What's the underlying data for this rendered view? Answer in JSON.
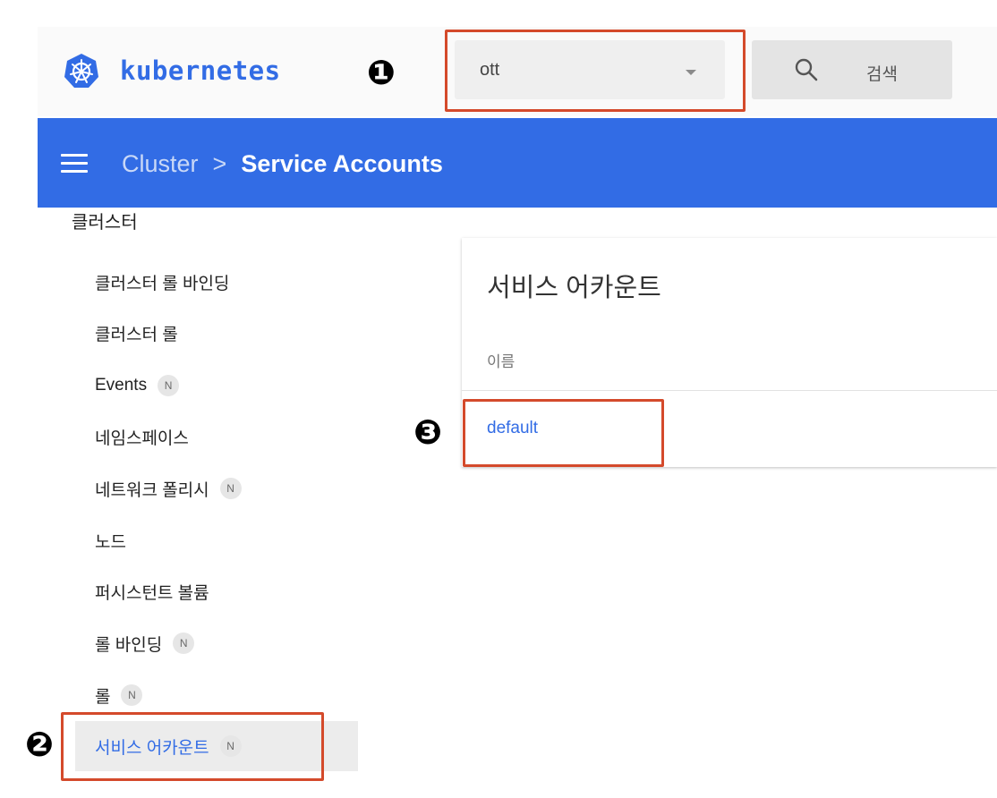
{
  "brand": {
    "name": "kubernetes",
    "color": "#326ce5"
  },
  "namespace_select": {
    "value": "ott"
  },
  "search": {
    "label": "검색"
  },
  "breadcrumb": {
    "parent": "Cluster",
    "separator": ">",
    "current": "Service Accounts"
  },
  "sidebar": {
    "section_title": "클러스터",
    "items": [
      {
        "label": "클러스터 롤 바인딩",
        "badge": ""
      },
      {
        "label": "클러스터 롤",
        "badge": ""
      },
      {
        "label": "Events",
        "badge": "N"
      },
      {
        "label": "네임스페이스",
        "badge": ""
      },
      {
        "label": "네트워크 폴리시",
        "badge": "N"
      },
      {
        "label": "노드",
        "badge": ""
      },
      {
        "label": "퍼시스턴트 볼륨",
        "badge": ""
      },
      {
        "label": "롤 바인딩",
        "badge": "N"
      },
      {
        "label": "롤",
        "badge": "N"
      },
      {
        "label": "서비스 어카운트",
        "badge": "N",
        "active": true
      }
    ]
  },
  "main": {
    "card_title": "서비스 어카운트",
    "column_header": "이름",
    "rows": [
      "default"
    ]
  },
  "annotations": {
    "marker_1": "❶",
    "marker_2": "❷",
    "marker_3": "❸",
    "highlight_color": "#d44a2b"
  }
}
